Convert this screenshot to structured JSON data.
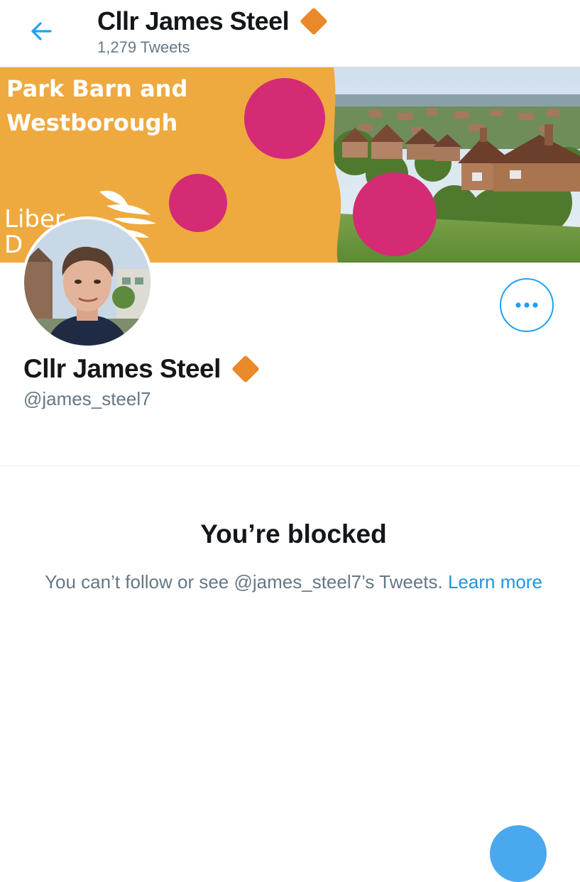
{
  "header": {
    "name": "Cllr James Steel",
    "tweet_count": "1,279 Tweets",
    "back_icon": "arrow-left-icon",
    "verified_icon": "orange-diamond-icon"
  },
  "banner": {
    "line1": "Park Barn and",
    "line2": "Westborough",
    "brand_line1": "Liber",
    "brand_line2": "D",
    "colors": {
      "orange": "#eea93f",
      "magenta": "#d42b74"
    }
  },
  "profile": {
    "name": "Cllr James Steel",
    "handle": "@james_steel7",
    "more_icon": "more-dots-icon"
  },
  "blocked": {
    "title": "You’re blocked",
    "message": "You can’t follow or see @james_steel7’s Tweets.",
    "link_text": "Learn more"
  },
  "theme": {
    "accent": "#1da1f2",
    "diamond": "#e8892a",
    "text_primary": "#14171a",
    "text_secondary": "#657786"
  }
}
